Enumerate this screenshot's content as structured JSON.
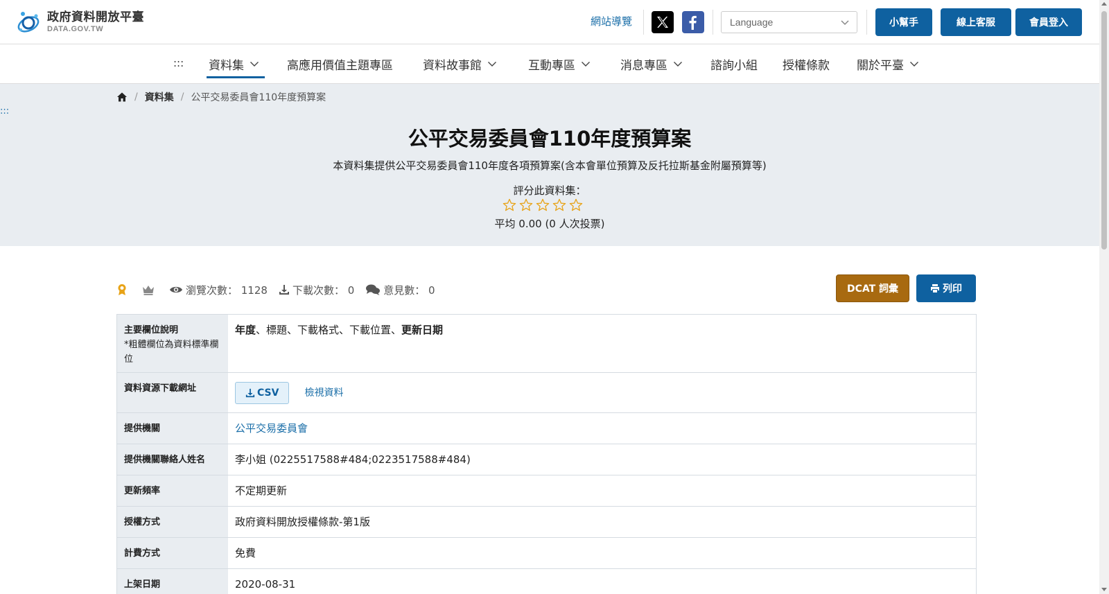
{
  "header": {
    "logo_title": "政府資料開放平臺",
    "logo_sub": "DATA.GOV.TW",
    "sitemap": "網站導覽",
    "language_placeholder": "Language",
    "help": "小幫手",
    "service": "線上客服",
    "login": "會員登入"
  },
  "nav": {
    "dots": ":::",
    "items": [
      {
        "label": "資料集"
      },
      {
        "label": "高應用價值主題專區"
      },
      {
        "label": "資料故事館"
      },
      {
        "label": "互動專區"
      },
      {
        "label": "消息專區"
      },
      {
        "label": "諮詢小組"
      },
      {
        "label": "授權條款"
      },
      {
        "label": "關於平臺"
      }
    ]
  },
  "breadcrumb": {
    "sep": "/",
    "items": [
      "資料集",
      "公平交易委員會110年度預算案"
    ]
  },
  "hero": {
    "dots": ":::",
    "title": "公平交易委員會110年度預算案",
    "description": "本資料集提供公平交易委員會110年度各項預算案(含本會單位預算及反托拉斯基金附屬預算等)",
    "rate_label": "評分此資料集：",
    "rating_value": 0,
    "rating_max": 5,
    "average": "平均 0.00 (0 人次投票)"
  },
  "stats": {
    "views": "瀏覽次數： 1128",
    "downloads": "下載次數： 0",
    "comments": "意見數： 0"
  },
  "actions": {
    "dcat": "DCAT 詞彙",
    "print": "列印"
  },
  "table": {
    "main_fields_label": "主要欄位說明",
    "main_fields_note": "*粗體欄位為資料標準欄位",
    "main_fields_bold_1": "年度",
    "main_fields_plain": "、標題、下載格式、下載位置、",
    "main_fields_bold_2": "更新日期",
    "download_label": "資料資源下載網址",
    "csv": "CSV",
    "view_data": "檢視資料",
    "org_label": "提供機關",
    "org_value": "公平交易委員會",
    "contact_label": "提供機關聯絡人姓名",
    "contact_value": "李小姐 (0225517588#484;0223517588#484)",
    "freq_label": "更新頻率",
    "freq_value": "不定期更新",
    "license_label": "授權方式",
    "license_value": "政府資料開放授權條款-第1版",
    "fee_label": "計費方式",
    "fee_value": "免費",
    "date_label": "上架日期",
    "date_value": "2020-08-31"
  },
  "colors": {
    "primary": "#0f61a0",
    "dcat": "#a86a10",
    "hero_bg": "#e9edf1",
    "star": "#e8a317"
  }
}
